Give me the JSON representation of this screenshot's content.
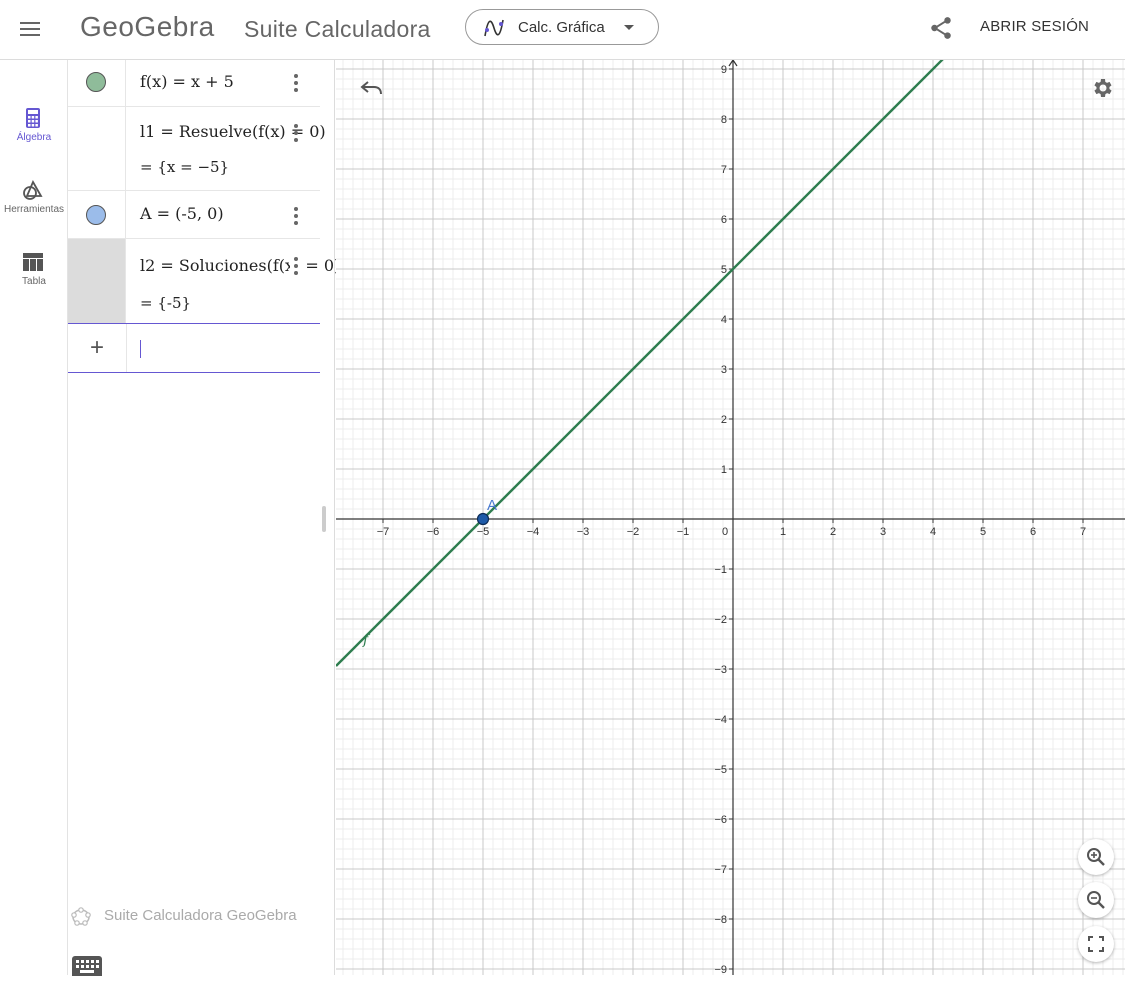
{
  "header": {
    "logo": "GeoGebra",
    "suite_title": "Suite Calculadora",
    "app_picker_label": "Calc. Gráfica",
    "login_label": "ABRIR SESIÓN"
  },
  "rail": {
    "items": [
      {
        "label": "Álgebra",
        "icon": "calculator-icon",
        "active": true
      },
      {
        "label": "Herramientas",
        "icon": "tools-icon",
        "active": false
      },
      {
        "label": "Tabla",
        "icon": "table-icon",
        "active": false
      }
    ]
  },
  "algebra": {
    "rows": [
      {
        "definition": "f(x) = x + 5",
        "marble_color": "#8fbc9a"
      },
      {
        "definition": "l1 = Resuelve(f(x) = 0)",
        "output": "= {x = −5}"
      },
      {
        "definition": "A = (-5, 0)",
        "marble_color": "#9bbcea"
      },
      {
        "definition": "l2 = Soluciones(f(x) = 0)",
        "output": "= {-5}"
      }
    ],
    "input_value": "",
    "footer_brand": "Suite Calculadora GeoGebra"
  },
  "graph": {
    "x_ticks": [
      "−7",
      "−6",
      "−5",
      "−4",
      "−3",
      "−2",
      "−1",
      "0",
      "1",
      "2",
      "3",
      "4",
      "5",
      "6",
      "7"
    ],
    "y_ticks": [
      "9",
      "8",
      "7",
      "6",
      "5",
      "4",
      "3",
      "2",
      "1",
      "−1",
      "−2",
      "−3",
      "−4",
      "−5",
      "−6",
      "−7",
      "−8",
      "−9"
    ],
    "function_label": "f",
    "point_label": "A",
    "point": {
      "x": -5,
      "y": 0
    },
    "function": {
      "slope": 1,
      "intercept": 5
    },
    "line_color": "#2e7d4f",
    "point_color": "#1e5aa8",
    "accent": "#6557d2"
  }
}
